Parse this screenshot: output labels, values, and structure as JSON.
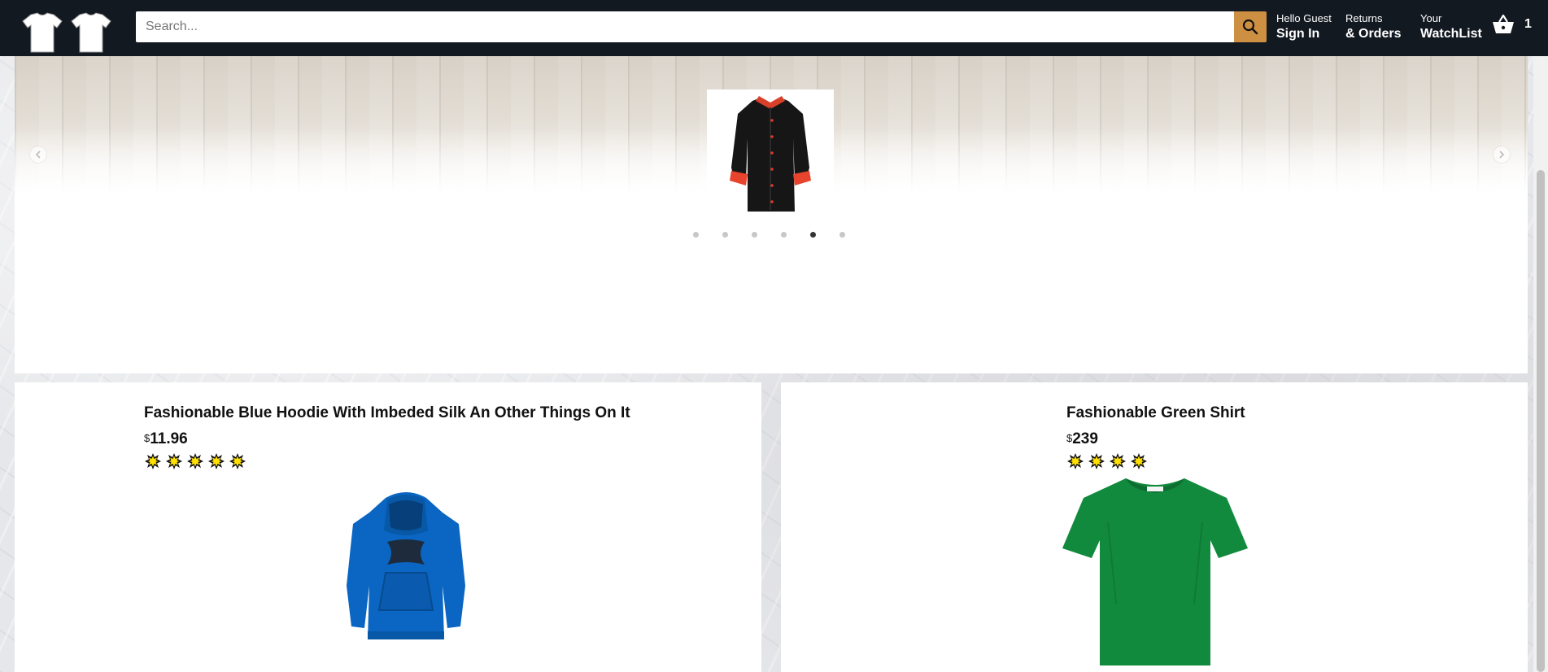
{
  "header": {
    "search_placeholder": "Search...",
    "greeting": "Hello Guest",
    "sign_in": "Sign In",
    "returns": "Returns",
    "orders": "& Orders",
    "your": "Your",
    "watchlist": "WatchList",
    "basket_count": "1"
  },
  "carousel": {
    "dot_count": 6,
    "active_dot": 5
  },
  "products": [
    {
      "title": "Fashionable Blue Hoodie With Imbeded Silk An Other Things On It",
      "currency": "$",
      "price": "11.96",
      "rating": 5,
      "image": "blue-hoodie"
    },
    {
      "title": "Fashionable Green Shirt",
      "currency": "$",
      "price": "239",
      "rating": 4,
      "image": "green-tshirt"
    }
  ],
  "colors": {
    "header_bg": "#131921",
    "search_button": "#cd9042",
    "star_fill": "#ffe000",
    "hoodie": "#0a66c2",
    "tshirt": "#128a3e"
  }
}
